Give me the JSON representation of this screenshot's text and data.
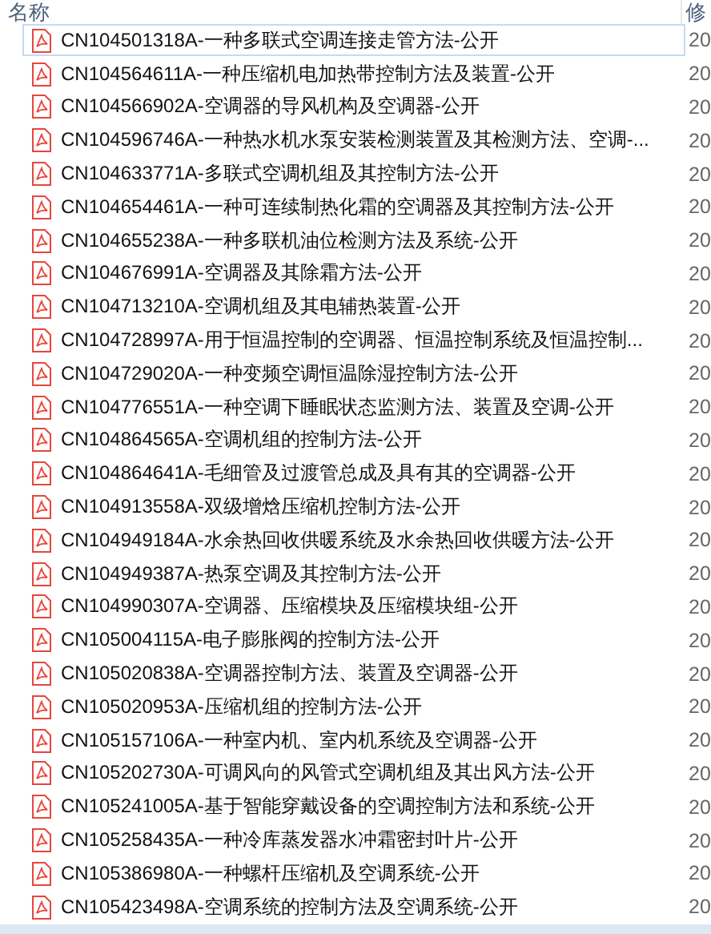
{
  "columns": [
    {
      "label": "名称"
    },
    {
      "label": "修"
    }
  ],
  "files": [
    {
      "name": "CN104501318A-一种多联式空调连接走管方法-公开",
      "date": "20",
      "focused": true
    },
    {
      "name": "CN104564611A-一种压缩机电加热带控制方法及装置-公开",
      "date": "20",
      "focused": false
    },
    {
      "name": "CN104566902A-空调器的导风机构及空调器-公开",
      "date": "20",
      "focused": false
    },
    {
      "name": "CN104596746A-一种热水机水泵安装检测装置及其检测方法、空调-...",
      "date": "20",
      "focused": false
    },
    {
      "name": "CN104633771A-多联式空调机组及其控制方法-公开",
      "date": "20",
      "focused": false
    },
    {
      "name": "CN104654461A-一种可连续制热化霜的空调器及其控制方法-公开",
      "date": "20",
      "focused": false
    },
    {
      "name": "CN104655238A-一种多联机油位检测方法及系统-公开",
      "date": "20",
      "focused": false
    },
    {
      "name": "CN104676991A-空调器及其除霜方法-公开",
      "date": "20",
      "focused": false
    },
    {
      "name": "CN104713210A-空调机组及其电辅热装置-公开",
      "date": "20",
      "focused": false
    },
    {
      "name": "CN104728997A-用于恒温控制的空调器、恒温控制系统及恒温控制...",
      "date": "20",
      "focused": false
    },
    {
      "name": "CN104729020A-一种变频空调恒温除湿控制方法-公开",
      "date": "20",
      "focused": false
    },
    {
      "name": "CN104776551A-一种空调下睡眠状态监测方法、装置及空调-公开",
      "date": "20",
      "focused": false
    },
    {
      "name": "CN104864565A-空调机组的控制方法-公开",
      "date": "20",
      "focused": false
    },
    {
      "name": "CN104864641A-毛细管及过渡管总成及具有其的空调器-公开",
      "date": "20",
      "focused": false
    },
    {
      "name": "CN104913558A-双级增焓压缩机控制方法-公开",
      "date": "20",
      "focused": false
    },
    {
      "name": "CN104949184A-水余热回收供暖系统及水余热回收供暖方法-公开",
      "date": "20",
      "focused": false
    },
    {
      "name": "CN104949387A-热泵空调及其控制方法-公开",
      "date": "20",
      "focused": false
    },
    {
      "name": "CN104990307A-空调器、压缩模块及压缩模块组-公开",
      "date": "20",
      "focused": false
    },
    {
      "name": "CN105004115A-电子膨胀阀的控制方法-公开",
      "date": "20",
      "focused": false
    },
    {
      "name": "CN105020838A-空调器控制方法、装置及空调器-公开",
      "date": "20",
      "focused": false
    },
    {
      "name": "CN105020953A-压缩机组的控制方法-公开",
      "date": "20",
      "focused": false
    },
    {
      "name": "CN105157106A-一种室内机、室内机系统及空调器-公开",
      "date": "20",
      "focused": false
    },
    {
      "name": "CN105202730A-可调风向的风管式空调机组及其出风方法-公开",
      "date": "20",
      "focused": false
    },
    {
      "name": "CN105241005A-基于智能穿戴设备的空调控制方法和系统-公开",
      "date": "20",
      "focused": false
    },
    {
      "name": "CN105258435A-一种冷库蒸发器水冲霜密封叶片-公开",
      "date": "20",
      "focused": false
    },
    {
      "name": "CN105386980A-一种螺杆压缩机及空调系统-公开",
      "date": "20",
      "focused": false
    },
    {
      "name": "CN105423498A-空调系统的控制方法及空调系统-公开",
      "date": "20",
      "focused": false
    }
  ]
}
